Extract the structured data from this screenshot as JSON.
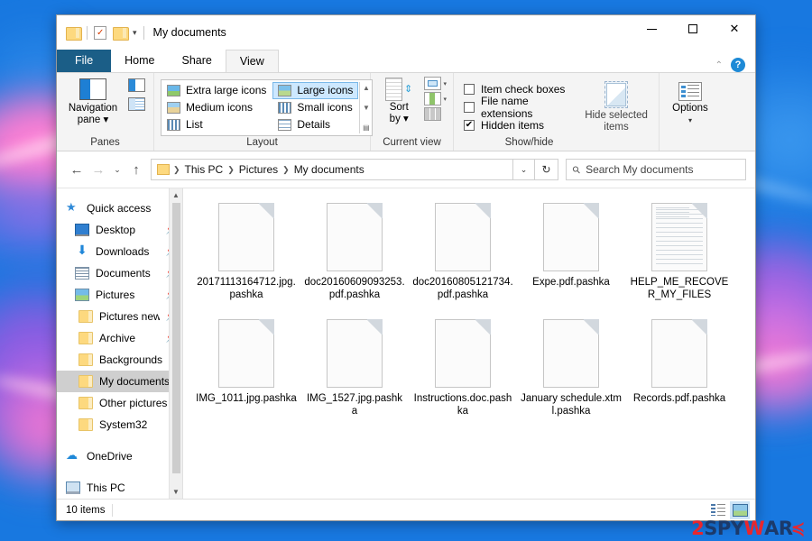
{
  "window": {
    "title": "My documents",
    "quick_access": [
      "folder-icon",
      "properties-icon",
      "new-folder-icon"
    ],
    "controls": {
      "minimize": "—",
      "maximize": "□",
      "close": "✕"
    },
    "help_label": "?"
  },
  "tabs": [
    {
      "label": "File",
      "active": false
    },
    {
      "label": "Home",
      "active": false
    },
    {
      "label": "Share",
      "active": false
    },
    {
      "label": "View",
      "active": true
    }
  ],
  "ribbon": {
    "panes": {
      "group_label": "Panes",
      "navigation_pane": "Navigation\npane",
      "navigation_pane_line1": "Navigation",
      "navigation_pane_line2": "pane"
    },
    "layout": {
      "group_label": "Layout",
      "options": [
        {
          "label": "Extra large icons",
          "selected": false
        },
        {
          "label": "Large icons",
          "selected": true
        },
        {
          "label": "Medium icons",
          "selected": false
        },
        {
          "label": "Small icons",
          "selected": false
        },
        {
          "label": "List",
          "selected": false
        },
        {
          "label": "Details",
          "selected": false
        }
      ]
    },
    "current_view": {
      "group_label": "Current view",
      "sort_by_line1": "Sort",
      "sort_by_line2": "by"
    },
    "show_hide": {
      "group_label": "Show/hide",
      "checkboxes": [
        {
          "label": "Item check boxes",
          "checked": false
        },
        {
          "label": "File name extensions",
          "checked": false
        },
        {
          "label": "Hidden items",
          "checked": true
        }
      ],
      "hide_selected_line1": "Hide selected",
      "hide_selected_line2": "items"
    },
    "options": {
      "label": "Options"
    }
  },
  "address": {
    "back": "←",
    "forward": "→",
    "recent": "⌄",
    "up": "↑",
    "breadcrumbs": [
      "This PC",
      "Pictures",
      "My documents"
    ],
    "dropdown": "⌄",
    "refresh": "↻"
  },
  "search": {
    "placeholder": "Search My documents",
    "icon": "search-icon"
  },
  "sidebar": {
    "items": [
      {
        "label": "Quick access",
        "icon": "star-icon",
        "pinned": false,
        "selected": false,
        "indent": 0
      },
      {
        "label": "Desktop",
        "icon": "desktop-icon",
        "pinned": true,
        "selected": false,
        "indent": 1
      },
      {
        "label": "Downloads",
        "icon": "downloads-icon",
        "pinned": true,
        "selected": false,
        "indent": 1
      },
      {
        "label": "Documents",
        "icon": "documents-icon",
        "pinned": true,
        "selected": false,
        "indent": 1
      },
      {
        "label": "Pictures",
        "icon": "pictures-icon",
        "pinned": true,
        "selected": false,
        "indent": 1
      },
      {
        "label": "Pictures new",
        "icon": "folder-icon",
        "pinned": true,
        "selected": false,
        "indent": 1
      },
      {
        "label": "Archive",
        "icon": "folder-icon",
        "pinned": true,
        "selected": false,
        "indent": 1
      },
      {
        "label": "Backgrounds",
        "icon": "folder-icon",
        "pinned": false,
        "selected": false,
        "indent": 1
      },
      {
        "label": "My documents",
        "icon": "folder-icon",
        "pinned": false,
        "selected": true,
        "indent": 1
      },
      {
        "label": "Other pictures",
        "icon": "folder-icon",
        "pinned": false,
        "selected": false,
        "indent": 1
      },
      {
        "label": "System32",
        "icon": "folder-icon",
        "pinned": false,
        "selected": false,
        "indent": 1
      },
      {
        "label": "OneDrive",
        "icon": "cloud-icon",
        "pinned": false,
        "selected": false,
        "indent": 0
      },
      {
        "label": "This PC",
        "icon": "pc-icon",
        "pinned": false,
        "selected": false,
        "indent": 0
      }
    ]
  },
  "files": [
    {
      "name": "20171113164712.jpg.pashka",
      "icon": "blank-file-icon"
    },
    {
      "name": "doc20160609093253.pdf.pashka",
      "icon": "blank-file-icon"
    },
    {
      "name": "doc20160805121734.pdf.pashka",
      "icon": "blank-file-icon"
    },
    {
      "name": "Expe.pdf.pashka",
      "icon": "blank-file-icon"
    },
    {
      "name": "HELP_ME_RECOVER_MY_FILES",
      "icon": "text-file-icon"
    },
    {
      "name": "IMG_1011.jpg.pashka",
      "icon": "blank-file-icon"
    },
    {
      "name": "IMG_1527.jpg.pashka",
      "icon": "blank-file-icon"
    },
    {
      "name": "Instructions.doc.pashka",
      "icon": "blank-file-icon"
    },
    {
      "name": "January schedule.xtml.pashka",
      "icon": "blank-file-icon"
    },
    {
      "name": "Records.pdf.pashka",
      "icon": "blank-file-icon"
    }
  ],
  "status": {
    "item_count": "10 items",
    "view_buttons": [
      {
        "name": "details-view",
        "selected": false
      },
      {
        "name": "large-icons-view",
        "selected": true
      }
    ]
  },
  "watermark": {
    "part1": "2",
    "part2": "SPY",
    "part3": "W",
    "part4": "AR",
    "part5": "≼"
  },
  "colors": {
    "accent": "#1b5e87",
    "selection": "#cde8ff",
    "desktop": "#1878e0"
  }
}
